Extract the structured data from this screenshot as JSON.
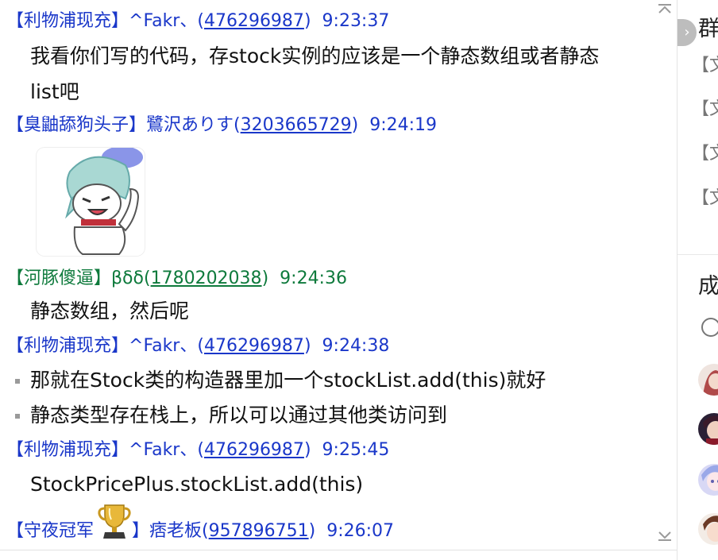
{
  "messages": [
    {
      "sender_title": "【利物浦现充】",
      "sender_name": "^Fakr、",
      "qq": "476296987",
      "time": "9:23:37",
      "lines": [
        "我看你们写的代码，存stock实例的应该是一个静态数组或者静态",
        "list吧"
      ]
    },
    {
      "sender_title": "【臭鼬舔狗头子】",
      "sender_name": "鷺沢ありす",
      "qq": "3203665729",
      "time": "9:24:19"
    },
    {
      "sender_title": "【河豚傻逼】",
      "sender_name": "βδδ",
      "qq": "1780202038",
      "time": "9:24:36",
      "lines": [
        "静态数组，然后呢"
      ]
    },
    {
      "sender_title": "【利物浦现充】",
      "sender_name": "^Fakr、",
      "qq": "476296987",
      "time": "9:24:38",
      "lines": [
        "那就在Stock类的构造器里加一个stockList.add(this)就好",
        "静态类型存在栈上，所以可以通过其他类访问到"
      ]
    },
    {
      "sender_title": "【利物浦现充】",
      "sender_name": "^Fakr、",
      "qq": "476296987",
      "time": "9:25:45",
      "lines": [
        "StockPricePlus.stockList.add(this)"
      ]
    },
    {
      "sender_title_open": "【守夜冠军",
      "sender_title_close": "】",
      "sender_name": "痞老板",
      "qq": "957896751",
      "time": "9:26:07"
    }
  ],
  "right_panel": {
    "group_title": "群",
    "file_items": [
      "【文",
      "【文",
      "【文",
      "【文"
    ],
    "members_title": "成"
  },
  "icons": {
    "scroll_up": "chevron-up-icon",
    "scroll_down": "chevron-down-icon",
    "collapse": "chevron-right-icon",
    "trophy": "trophy-icon",
    "sticker": "anime-sticker"
  },
  "colors": {
    "sender_blue": "#1a37c9",
    "sender_green": "#0e7a3c"
  }
}
